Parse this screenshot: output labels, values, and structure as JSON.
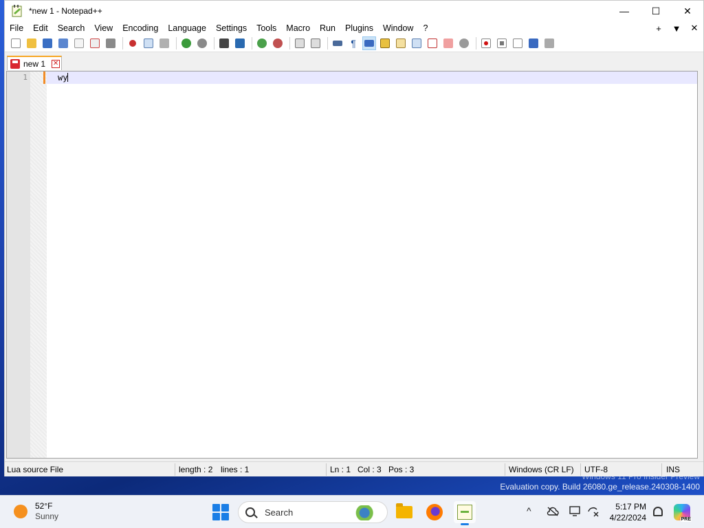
{
  "window": {
    "title": "*new 1 - Notepad++",
    "controls": {
      "minimize": "—",
      "maximize": "☐",
      "close": "✕"
    }
  },
  "menu": {
    "items": [
      "File",
      "Edit",
      "Search",
      "View",
      "Encoding",
      "Language",
      "Settings",
      "Tools",
      "Macro",
      "Run",
      "Plugins",
      "Window",
      "?"
    ],
    "right": {
      "add": "+",
      "dropdown": "▼",
      "close": "✕"
    }
  },
  "toolbar": {
    "icons": [
      "new-file-icon",
      "open-file-icon",
      "save-icon",
      "save-all-icon",
      "close-icon",
      "close-all-icon",
      "print-icon",
      "cut-icon",
      "copy-icon",
      "paste-icon",
      "undo-icon",
      "redo-icon",
      "find-icon",
      "replace-icon",
      "zoom-in-icon",
      "zoom-out-icon",
      "sync-vertical-icon",
      "sync-horizontal-icon",
      "word-wrap-icon",
      "show-all-chars-icon",
      "indent-guide-icon",
      "user-language-icon",
      "doc-map-icon",
      "document-list-icon",
      "function-list-icon",
      "folder-workspace-icon",
      "monitoring-icon",
      "record-macro-icon",
      "stop-record-icon",
      "playback-icon",
      "run-multiple-icon",
      "save-macro-icon"
    ]
  },
  "tab": {
    "name": "new 1",
    "close": "✕"
  },
  "editor": {
    "line_number": "1",
    "content": "wy"
  },
  "status": {
    "language": "Lua source File",
    "length": "length : 2",
    "lines": "lines : 1",
    "ln": "Ln : 1",
    "col": "Col : 3",
    "pos": "Pos : 3",
    "eol": "Windows (CR LF)",
    "encoding": "UTF-8",
    "mode": "INS"
  },
  "watermark": {
    "line1": "Windows 11 Pro Insider Preview",
    "line2": "Evaluation copy. Build 26080.ge_release.240308-1400"
  },
  "taskbar": {
    "weather": {
      "temp": "52°F",
      "condition": "Sunny"
    },
    "search_label": "Search",
    "clock": {
      "time": "5:17 PM",
      "date": "4/22/2024"
    },
    "tray": {
      "chevron": "^"
    },
    "copilot_badge": "PRE"
  },
  "colors": {
    "accent": "#1a7ee6",
    "tab_highlight": "#f6a623",
    "current_line": "#e8e8ff"
  }
}
